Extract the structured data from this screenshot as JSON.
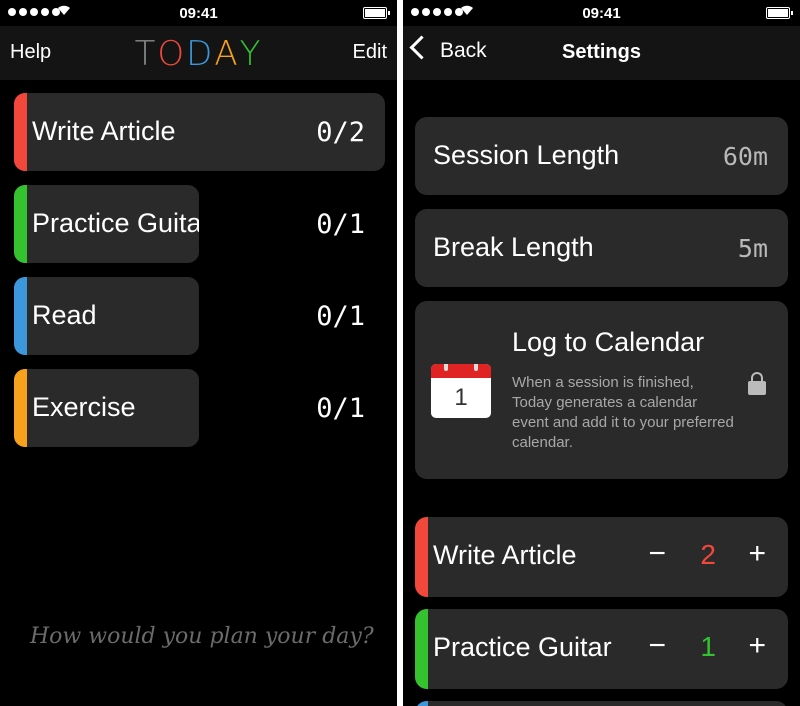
{
  "status": {
    "time": "09:41"
  },
  "left": {
    "nav": {
      "help": "Help",
      "edit": "Edit",
      "logo_letters": [
        "T",
        "O",
        "D",
        "A",
        "Y"
      ]
    },
    "tasks": [
      {
        "name": "Write Article",
        "count": "0/2",
        "color": "#f2483b"
      },
      {
        "name": "Practice Guitar",
        "count": "0/1",
        "color": "#34c32f"
      },
      {
        "name": "Read",
        "count": "0/1",
        "color": "#3d97dc"
      },
      {
        "name": "Exercise",
        "count": "0/1",
        "color": "#f7a11c"
      }
    ],
    "prompt": "How would you plan your day?"
  },
  "right": {
    "nav": {
      "back": "Back",
      "title": "Settings"
    },
    "session": {
      "label": "Session Length",
      "value": "60m"
    },
    "break": {
      "label": "Break Length",
      "value": "5m"
    },
    "calendar": {
      "day": "1",
      "title": "Log to Calendar",
      "description": "When a session is finished, Today generates a calendar event and add it to your preferred calendar."
    },
    "steppers": [
      {
        "name": "Write Article",
        "value": "2",
        "color": "#f2483b",
        "minus": "−",
        "plus": "+"
      },
      {
        "name": "Practice Guitar",
        "value": "1",
        "color": "#34c32f",
        "minus": "−",
        "plus": "+"
      }
    ],
    "peek_color": "#3d97dc"
  },
  "logo_colors": [
    "#8a8a8a",
    "#f2483b",
    "#3d97dc",
    "#f7a11c",
    "#34c32f"
  ]
}
